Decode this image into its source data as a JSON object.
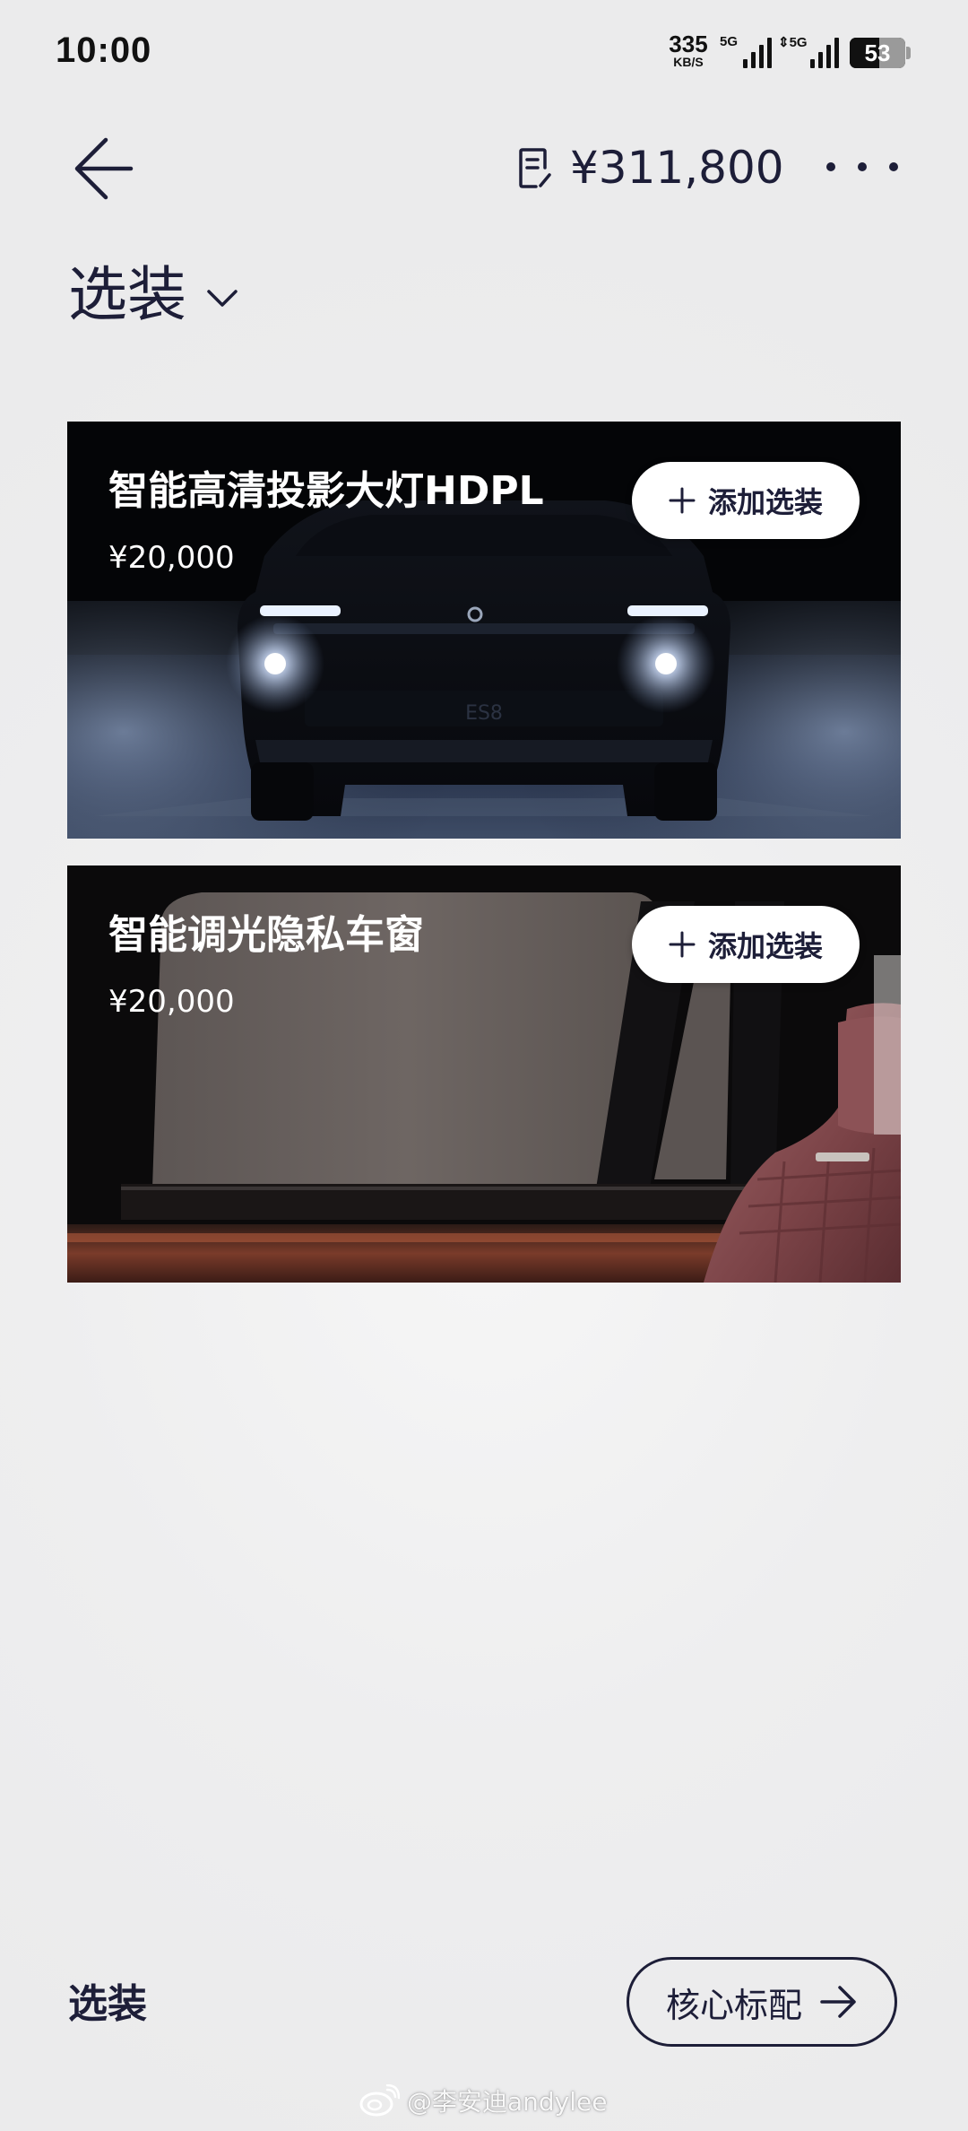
{
  "status_bar": {
    "time": "10:00",
    "net_speed": "335",
    "net_speed_unit": "KB/S",
    "signal_1_label": "5G",
    "signal_2_label": "5G",
    "battery": "53"
  },
  "header": {
    "total_price": "¥311,800",
    "back_icon": "arrow-left-icon",
    "quote_icon": "document-edit-icon",
    "more_icon": "more-dots-icon"
  },
  "section": {
    "title": "选装",
    "dropdown_icon": "chevron-down-icon"
  },
  "options": [
    {
      "name": "智能高清投影大灯HDPL",
      "price": "¥20,000",
      "button_label": "添加选装"
    },
    {
      "name": "智能调光隐私车窗",
      "price": "¥20,000",
      "button_label": "添加选装"
    }
  ],
  "bottom_bar": {
    "current_label": "选装",
    "next_button_label": "核心标配",
    "next_icon": "arrow-right-icon"
  },
  "watermark": {
    "text": "@李安迪andylee",
    "icon": "weibo-icon"
  },
  "colors": {
    "text_primary": "#1d1e38",
    "background": "#ededee",
    "card_background": "#050608",
    "button_background": "#ffffff"
  }
}
